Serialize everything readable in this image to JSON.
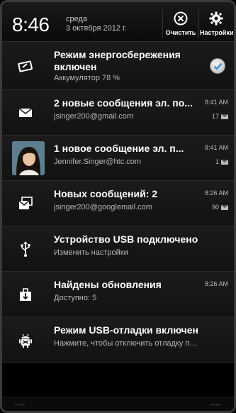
{
  "header": {
    "time": "8:46",
    "weekday": "среда",
    "date": "3 октября 2012 г.",
    "clear_label": "Очистить",
    "settings_label": "Настройки"
  },
  "notifications": [
    {
      "title": "Режим энергосбережения включен",
      "subtitle": "Аккумулятор 78 %",
      "icon": "battery-saver-icon",
      "checked": true
    },
    {
      "title": "2 новые сообщения эл. по...",
      "subtitle": "jsinger200@gmail.com",
      "time": "8:41 AM",
      "count": "17",
      "icon": "mail-icon"
    },
    {
      "title": "1 новое сообщение эл. п...",
      "subtitle": "Jennifer.Singer@htc.com",
      "time": "8:41 AM",
      "count": "1",
      "icon": "contact-avatar"
    },
    {
      "title": "Новых сообщений: 2",
      "subtitle": "jsinger200@googlemail.com",
      "time": "8:26 AM",
      "count": "90",
      "icon": "mail-stack-icon"
    },
    {
      "title": "Устройство USB подключено",
      "subtitle": "Изменить настройки",
      "icon": "usb-icon"
    },
    {
      "title": "Найдены обновления",
      "subtitle": "Доступно: 5",
      "time": "8:26 AM",
      "icon": "download-icon"
    },
    {
      "title": "Режим USB-отладки включен",
      "subtitle": "Нажмите, чтобы отключить отладку по...",
      "icon": "android-debug-icon"
    }
  ],
  "colors": {
    "background": "#000000",
    "row": "#161616",
    "accent_check": "#3a8fd8"
  }
}
